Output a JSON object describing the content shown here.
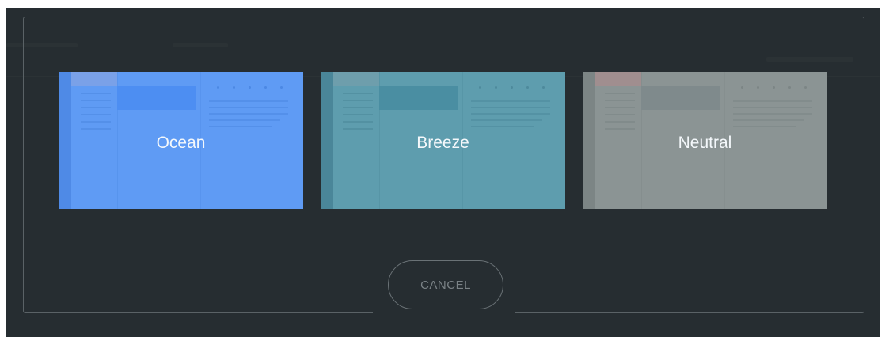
{
  "dialog": {
    "themes": [
      {
        "label": "Ocean",
        "colors": {
          "bg": "#5f9bf4",
          "sidebar": "#4f8ae6",
          "logo": "#7aa1e8",
          "header": "#4d8ef2",
          "line": "#4a86e0",
          "dot": "#3f7bd8"
        }
      },
      {
        "label": "Breeze",
        "colors": {
          "bg": "#5e9dae",
          "sidebar": "#4a8699",
          "logo": "#6e9eac",
          "header": "#4a8ea2",
          "line": "#4a8799",
          "dot": "#427d90"
        }
      },
      {
        "label": "Neutral",
        "colors": {
          "bg": "#8b9494",
          "sidebar": "#7c8585",
          "logo": "#a08e8f",
          "header": "#7f8a8c",
          "line": "#7a8484",
          "dot": "#737c7c"
        }
      }
    ],
    "cancel_label": "CANCEL"
  },
  "colors": {
    "overlay_bg": "#262d31",
    "frame_border": "#5a6266",
    "cancel_text": "#7a8286"
  }
}
